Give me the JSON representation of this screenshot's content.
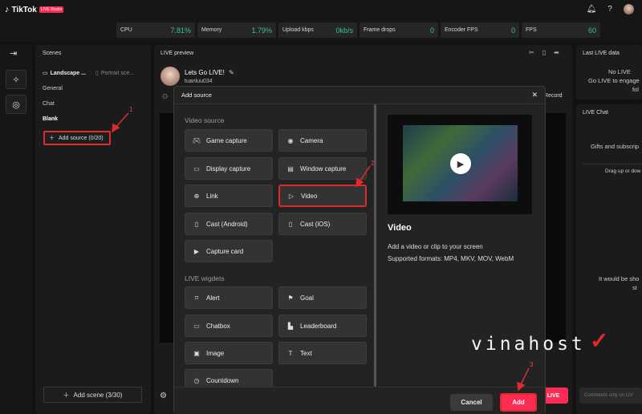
{
  "app": {
    "logo": "TikTok",
    "badge": "LIVE Studio"
  },
  "stats": [
    {
      "label": "CPU",
      "value": "7.81%"
    },
    {
      "label": "Memory",
      "value": "1.79%"
    },
    {
      "label": "Upload kbps",
      "value": "0kb/s"
    },
    {
      "label": "Frame drops",
      "value": "0"
    },
    {
      "label": "Encoder FPS",
      "value": "0"
    },
    {
      "label": "FPS",
      "value": "60"
    }
  ],
  "top_icons": [
    "bell-icon",
    "help-icon",
    "avatar"
  ],
  "rail": [
    "collapse-icon",
    "sparkle-icon",
    "target-icon"
  ],
  "scenes": {
    "title": "Scenes",
    "tabs": [
      "Landscape ...",
      "Portrait sce..."
    ],
    "items": [
      "General",
      "Chat",
      "Blank"
    ],
    "add_source": "Add source (0/20)",
    "add_scene": "Add scene (3/30)"
  },
  "preview": {
    "title": "LIVE preview",
    "stream_title": "Lets Go LIVE!",
    "username": "tuanluu034",
    "record": "Record",
    "go_live_partial": "LIVE"
  },
  "right": {
    "data_title": "Last LIVE data",
    "data_line1": "No LIVE",
    "data_line2": "Go LIVE to engage",
    "data_line3": "fol",
    "chat_title": "LIVE Chat",
    "chat_line1": "Gifts and subscrip",
    "chat_line2": "Drag up or dow",
    "chat_line3": "It would be sho",
    "chat_line4": "st",
    "comments_placeholder": "Comments only on LIV"
  },
  "modal": {
    "title": "Add source",
    "video_section": "Video source",
    "video_sources": [
      {
        "label": "Game capture",
        "icon": "gamepad-icon"
      },
      {
        "label": "Camera",
        "icon": "camera-icon"
      },
      {
        "label": "Display capture",
        "icon": "monitor-icon"
      },
      {
        "label": "Window capture",
        "icon": "window-icon"
      },
      {
        "label": "Link",
        "icon": "globe-icon"
      },
      {
        "label": "Video",
        "icon": "play-icon"
      },
      {
        "label": "Cast (Android)",
        "icon": "phone-icon"
      },
      {
        "label": "Cast (iOS)",
        "icon": "phone-icon"
      },
      {
        "label": "Capture card",
        "icon": "video-card-icon"
      }
    ],
    "widgets_section": "LIVE wigdets",
    "widgets": [
      {
        "label": "Alert",
        "icon": "alert-icon"
      },
      {
        "label": "Goal",
        "icon": "goal-icon"
      },
      {
        "label": "Chatbox",
        "icon": "chat-icon"
      },
      {
        "label": "Leaderboard",
        "icon": "leaderboard-icon"
      },
      {
        "label": "Image",
        "icon": "image-icon"
      },
      {
        "label": "Text",
        "icon": "text-icon"
      },
      {
        "label": "Countdown",
        "icon": "clock-icon"
      }
    ],
    "detail_title": "Video",
    "detail_desc1": "Add a video or clip to your screen",
    "detail_desc2": "Supported formats: MP4, MKV, MOV, WebM",
    "cancel": "Cancel",
    "add": "Add"
  },
  "annotations": [
    "1",
    "2",
    "3"
  ],
  "watermark": "vinahost",
  "colors": {
    "accent": "#fe2c55",
    "stat_green": "#39c48e",
    "highlight": "#e02b2b"
  }
}
